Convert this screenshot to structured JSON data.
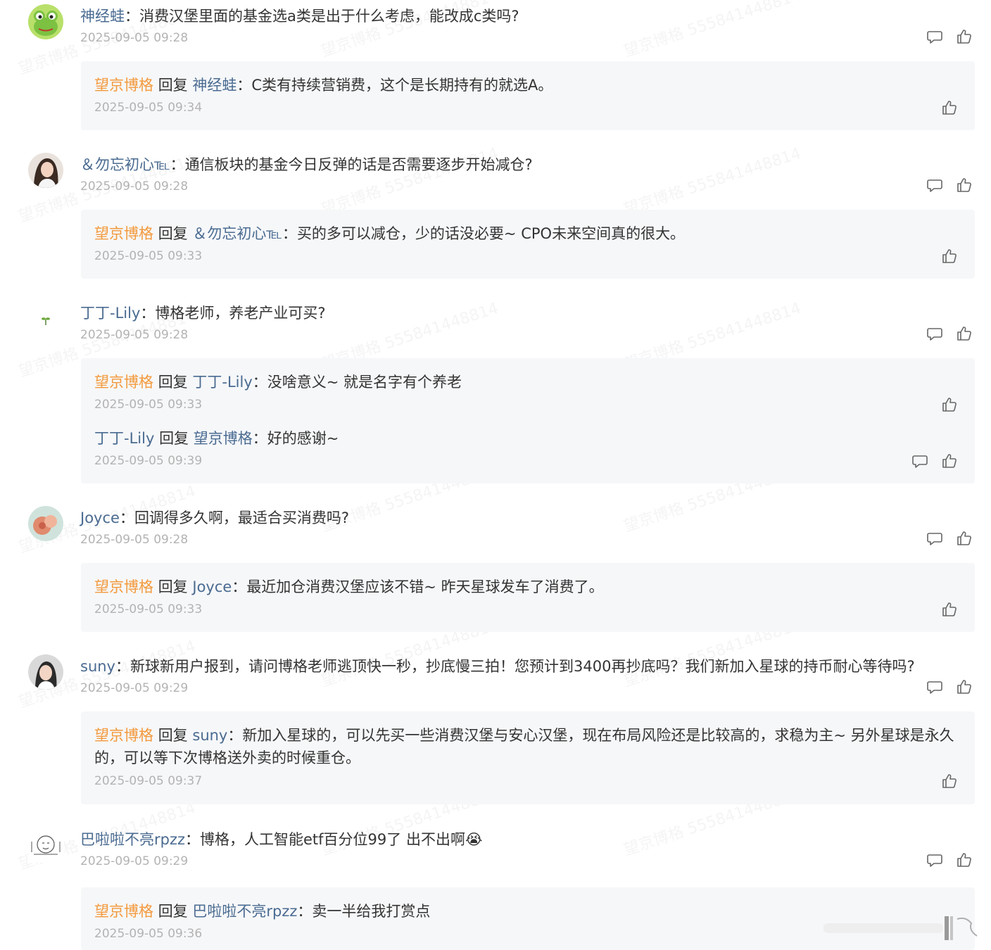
{
  "watermark_text": "望京博格 555841448814",
  "comments": [
    {
      "user": "神经蛙",
      "text": "消费汉堡里面的基金选a类是出于什么考虑，能改成c类吗?",
      "time": "2025-09-05 09:28",
      "avatar": "frog-avatar",
      "replies": [
        {
          "from": "望京博格",
          "verb": "回复",
          "to": "神经蛙",
          "text": "C类有持续营销费，这个是长期持有的就选A。",
          "time": "2025-09-05 09:34"
        }
      ]
    },
    {
      "user": "＆勿忘初心℡",
      "text": "通信板块的基金今日反弹的话是否需要逐步开始减仓?",
      "time": "2025-09-05 09:28",
      "avatar": "woman-avatar",
      "replies": [
        {
          "from": "望京博格",
          "verb": "回复",
          "to": "＆勿忘初心℡",
          "text": "买的多可以减仓，少的话没必要~ CPO未来空间真的很大。",
          "time": "2025-09-05 09:33"
        }
      ]
    },
    {
      "user": "丁丁-Lily",
      "text": "博格老师，养老产业可买?",
      "time": "2025-09-05 09:28",
      "avatar": "sprout-avatar",
      "replies": [
        {
          "from": "望京博格",
          "verb": "回复",
          "to": "丁丁-Lily",
          "text": "没啥意义~ 就是名字有个养老",
          "time": "2025-09-05 09:33"
        },
        {
          "from": "丁丁-Lily",
          "verb": "回复",
          "to": "望京博格",
          "text": "好的感谢~",
          "time": "2025-09-05 09:39"
        }
      ]
    },
    {
      "user": "Joyce",
      "text": "回调得多久啊，最适合买消费吗?",
      "time": "2025-09-05 09:28",
      "avatar": "flower-avatar",
      "replies": [
        {
          "from": "望京博格",
          "verb": "回复",
          "to": "Joyce",
          "text": "最近加仓消费汉堡应该不错~  昨天星球发车了消费了。",
          "time": "2025-09-05 09:33"
        }
      ]
    },
    {
      "user": "suny",
      "text": "新球新用户报到，请问博格老师逃顶快一秒，抄底慢三拍！您预计到3400再抄底吗？我们新加入星球的持币耐心等待吗?",
      "time": "2025-09-05 09:29",
      "avatar": "girl-avatar",
      "replies": [
        {
          "from": "望京博格",
          "verb": "回复",
          "to": "suny",
          "text": "新加入星球的，可以先买一些消费汉堡与安心汉堡，现在布局风险还是比较高的，求稳为主~ 另外星球是永久的，可以等下次博格送外卖的时候重仓。",
          "time": "2025-09-05 09:37"
        }
      ]
    },
    {
      "user": "巴啦啦不亮rpzz",
      "text": "博格，人工智能etf百分位99了 出不出啊",
      "emoji": "😭",
      "time": "2025-09-05 09:29",
      "avatar": "sketch-avatar",
      "replies": [
        {
          "from": "望京博格",
          "verb": "回复",
          "to": "巴啦啦不亮rpzz",
          "text": "卖一半给我打赏点",
          "time": "2025-09-05 09:36"
        }
      ]
    }
  ]
}
